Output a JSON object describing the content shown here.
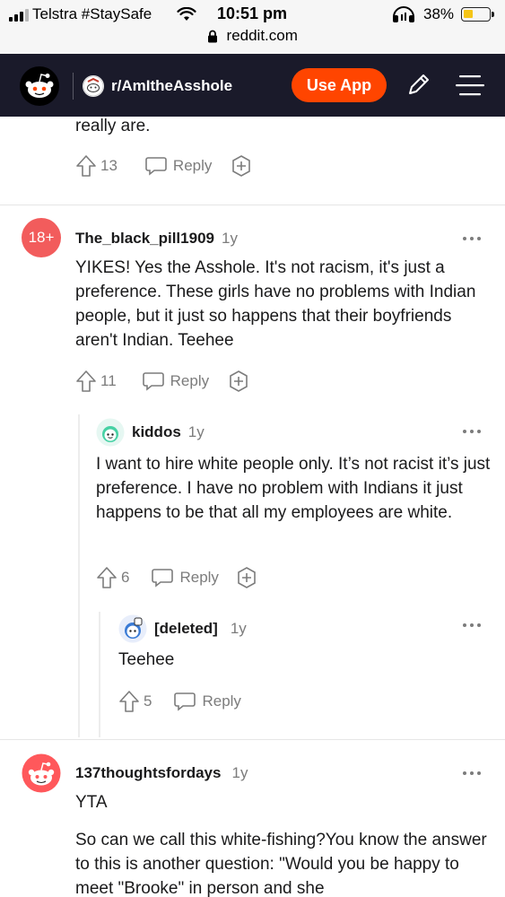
{
  "status_bar": {
    "carrier": "Telstra #StaySafe",
    "time": "10:51 pm",
    "battery_percent": "38%",
    "url": "reddit.com"
  },
  "header": {
    "subreddit": "r/AmItheAsshole",
    "use_app_label": "Use App",
    "accent_color": "#ff4500"
  },
  "comment0": {
    "text_tail": "really are.",
    "votes": "13",
    "reply_label": "Reply"
  },
  "comment1": {
    "avatar_badge": "18+",
    "username": "The_black_pill1909",
    "age": "1y",
    "text": "YIKES! Yes the Asshole. It's not racism, it's just a preference. These girls have no problems with Indian people, but it just so happens that their boyfriends aren't Indian. Teehee",
    "votes": "11",
    "reply_label": "Reply"
  },
  "comment2": {
    "username": "kiddos",
    "age": "1y",
    "text": "I want to hire white people only. It’s not racist it’s just preference. I have no problem with Indians it just happens to be that all my employees are white.",
    "votes": "6",
    "reply_label": "Reply"
  },
  "comment3": {
    "username": "[deleted]",
    "age": "1y",
    "text": "Teehee",
    "votes": "5",
    "reply_label": "Reply"
  },
  "comment4": {
    "username": "137thoughtsfordays",
    "age": "1y",
    "text_line1": "YTA",
    "text_para2": "So can we call this white-fishing?You know the answer to this is another question: \"Would you be happy to meet \"Brooke\" in person and she"
  }
}
